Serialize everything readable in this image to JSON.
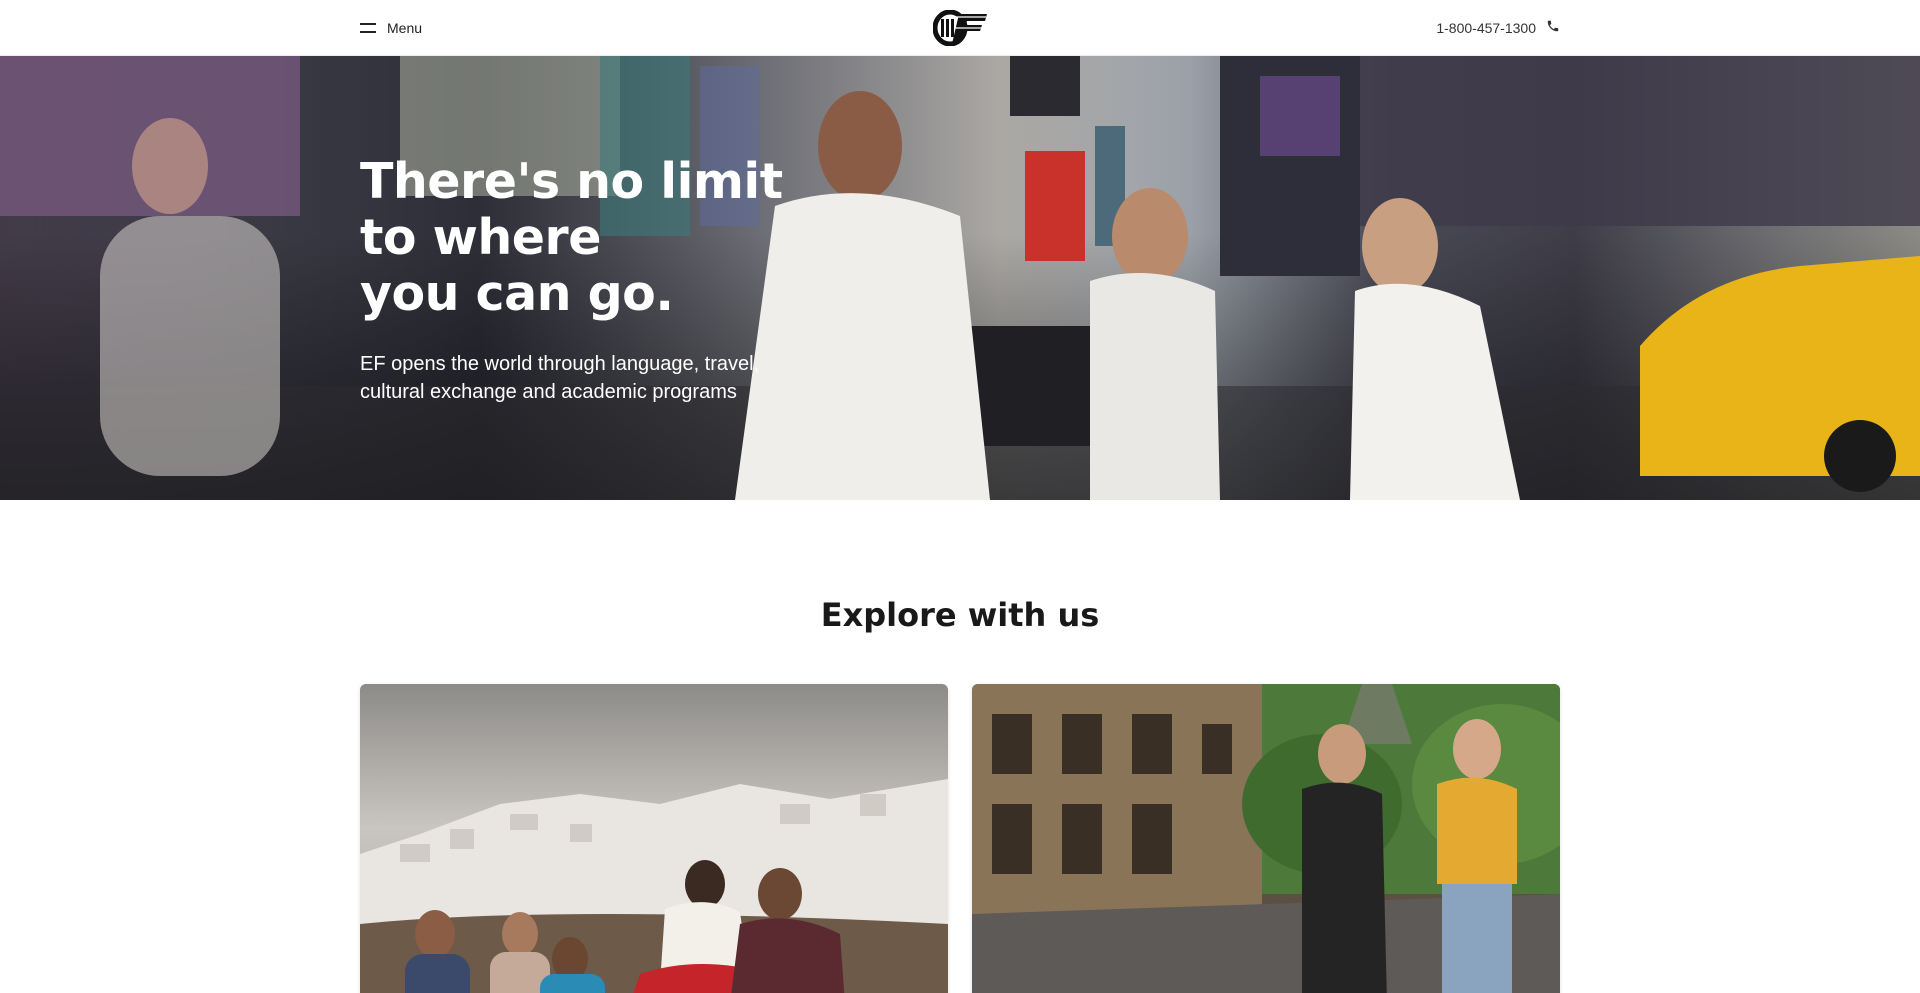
{
  "header": {
    "menu_label": "Menu",
    "logo_alt": "EF",
    "phone_number": "1-800-457-1300",
    "icons": {
      "menu": "hamburger-icon",
      "phone": "phone-icon"
    }
  },
  "hero": {
    "title_lines": [
      "There's no limit",
      "to where",
      "you can go."
    ],
    "subtitle": "EF opens the world through language, travel, cultural exchange and academic programs"
  },
  "explore": {
    "title": "Explore with us",
    "cards": [
      {
        "image": "group-on-hillside-santorini"
      },
      {
        "image": "friends-walking-paris-street"
      }
    ]
  },
  "colors": {
    "text": "#191919",
    "background": "#ffffff",
    "hero_text": "#ffffff",
    "taxi_yellow": "#e8b418"
  }
}
